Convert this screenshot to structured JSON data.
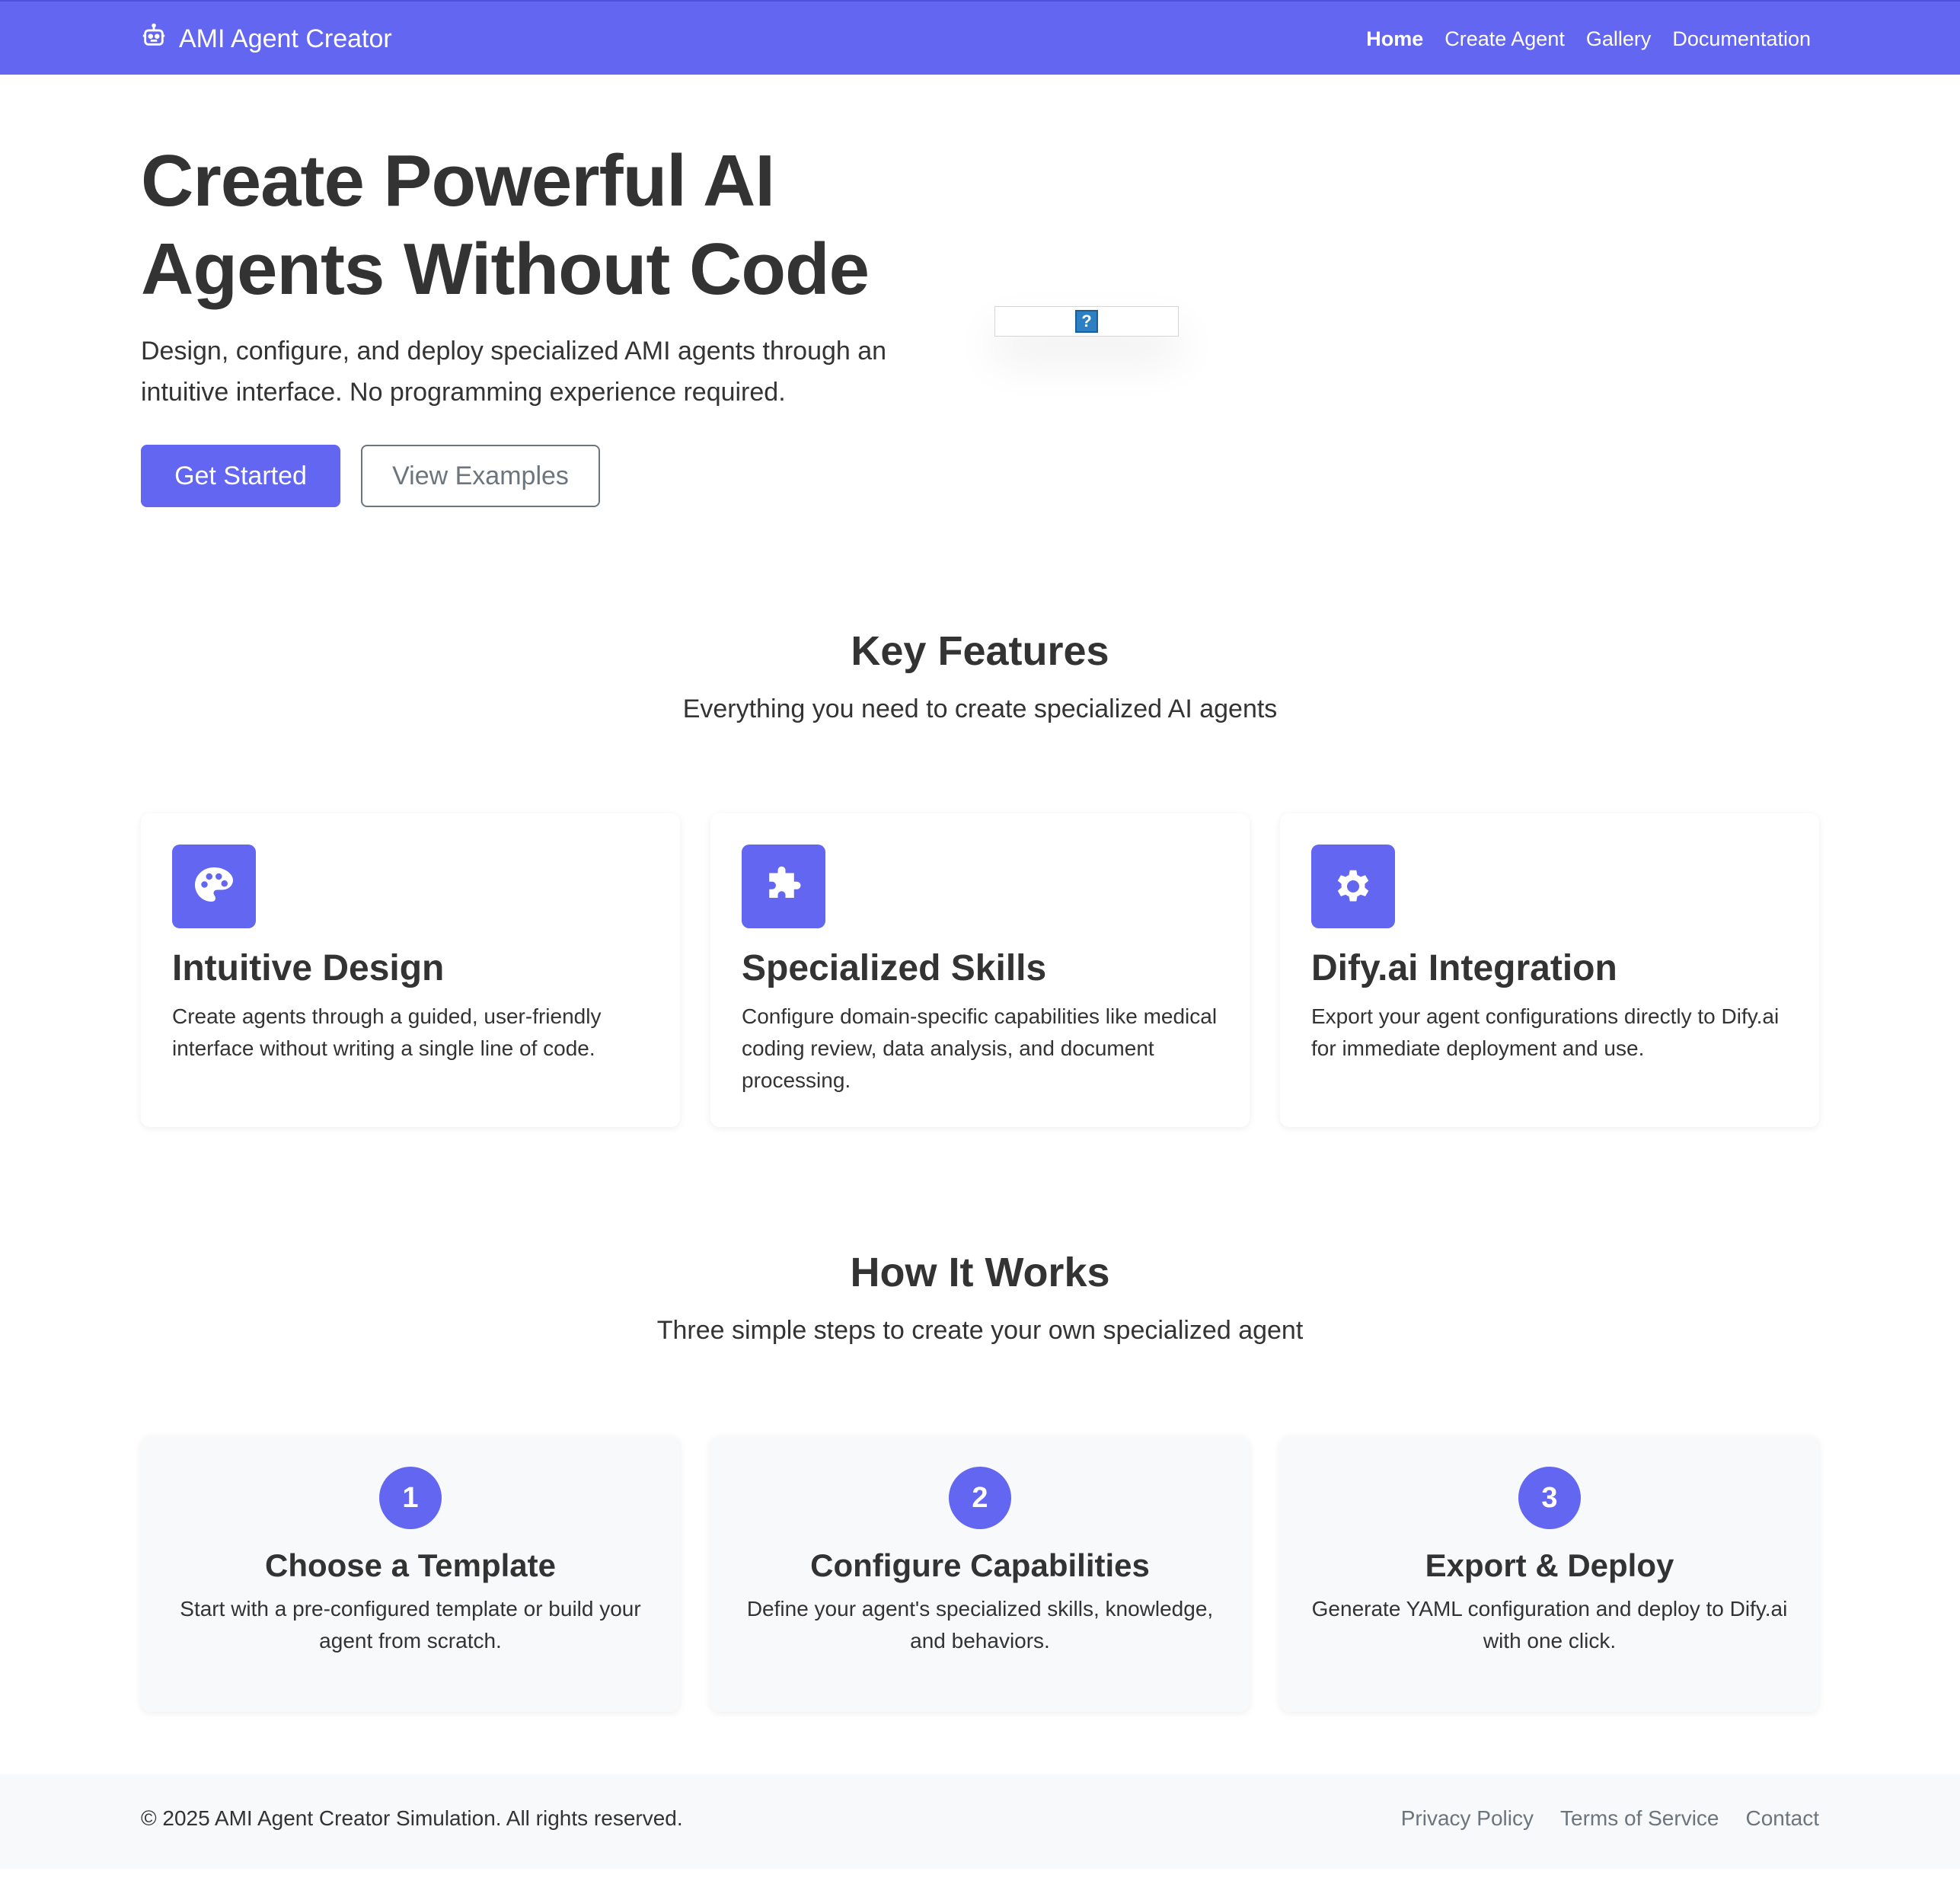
{
  "navbar": {
    "brand": "AMI Agent Creator",
    "brand_icon": "robot-icon",
    "links": [
      {
        "label": "Home",
        "active": true
      },
      {
        "label": "Create Agent",
        "active": false
      },
      {
        "label": "Gallery",
        "active": false
      },
      {
        "label": "Documentation",
        "active": false
      }
    ]
  },
  "hero": {
    "title": "Create Powerful AI Agents Without Code",
    "subtitle": "Design, configure, and deploy specialized AMI agents through an intuitive interface. No programming experience required.",
    "primary_button": "Get Started",
    "secondary_button": "View Examples",
    "broken_image_glyph": "?"
  },
  "features": {
    "title": "Key Features",
    "subtitle": "Everything you need to create specialized AI agents",
    "items": [
      {
        "icon": "palette-icon",
        "title": "Intuitive Design",
        "description": "Create agents through a guided, user-friendly interface without writing a single line of code."
      },
      {
        "icon": "puzzle-icon",
        "title": "Specialized Skills",
        "description": "Configure domain-specific capabilities like medical coding review, data analysis, and document processing."
      },
      {
        "icon": "gear-icon",
        "title": "Dify.ai Integration",
        "description": "Export your agent configurations directly to Dify.ai for immediate deployment and use."
      }
    ]
  },
  "how_it_works": {
    "title": "How It Works",
    "subtitle": "Three simple steps to create your own specialized agent",
    "steps": [
      {
        "number": "1",
        "title": "Choose a Template",
        "description": "Start with a pre-configured template or build your agent from scratch."
      },
      {
        "number": "2",
        "title": "Configure Capabilities",
        "description": "Define your agent's specialized skills, knowledge, and behaviors."
      },
      {
        "number": "3",
        "title": "Export & Deploy",
        "description": "Generate YAML configuration and deploy to Dify.ai with one click."
      }
    ]
  },
  "footer": {
    "copyright": "© 2025 AMI Agent Creator Simulation. All rights reserved.",
    "links": [
      "Privacy Policy",
      "Terms of Service",
      "Contact"
    ]
  },
  "colors": {
    "primary": "#6366f1",
    "text": "#333333",
    "muted": "#6c757d",
    "light_bg": "#f8f9fa"
  }
}
